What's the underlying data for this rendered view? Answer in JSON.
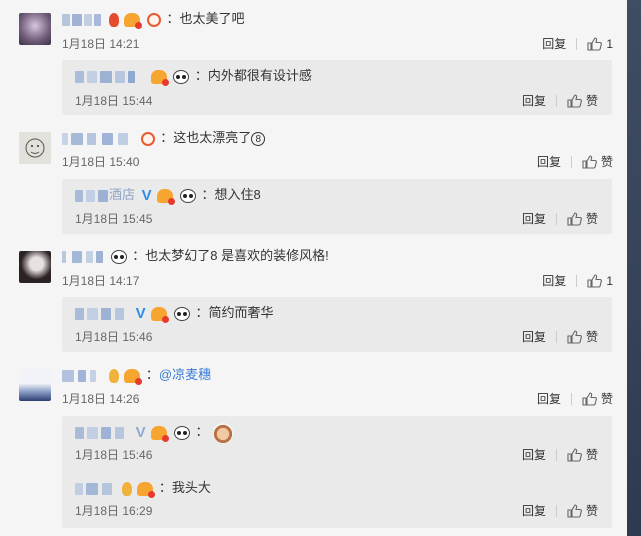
{
  "labels": {
    "reply": "回复",
    "like": "赞"
  },
  "comments": [
    {
      "text": "也太美了吧",
      "time": "1月18日 14:21",
      "like_count": "1",
      "replies": [
        {
          "text": "内外都很有设计感",
          "time": "1月18日 15:44"
        }
      ]
    },
    {
      "text": "这也太漂亮了",
      "text_suffix": "8",
      "time": "1月18日 15:40",
      "like_count": "赞",
      "replies": [
        {
          "name_suffix": "酒店",
          "text": "想入住8",
          "time": "1月18日 15:45"
        }
      ]
    },
    {
      "text": "也太梦幻了8  是喜欢的装修风格!",
      "time": "1月18日 14:17",
      "like_count": "1",
      "replies": [
        {
          "text": "简约而奢华",
          "time": "1月18日 15:46"
        }
      ]
    },
    {
      "text": "@凉麦穗",
      "time": "1月18日 14:26",
      "like_count": "赞",
      "replies": [
        {
          "text": "",
          "time": "1月18日 15:46"
        },
        {
          "text": "我头大",
          "time": "1月18日 16:29"
        }
      ]
    }
  ]
}
